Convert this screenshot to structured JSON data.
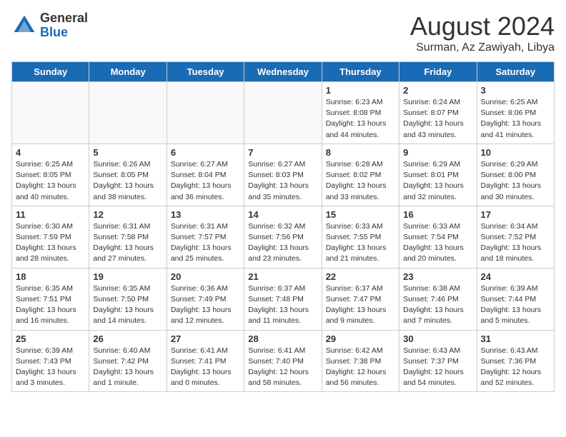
{
  "header": {
    "logo_general": "General",
    "logo_blue": "Blue",
    "month_year": "August 2024",
    "location": "Surman, Az Zawiyah, Libya"
  },
  "days_of_week": [
    "Sunday",
    "Monday",
    "Tuesday",
    "Wednesday",
    "Thursday",
    "Friday",
    "Saturday"
  ],
  "weeks": [
    [
      {
        "day": "",
        "info": "",
        "empty": true
      },
      {
        "day": "",
        "info": "",
        "empty": true
      },
      {
        "day": "",
        "info": "",
        "empty": true
      },
      {
        "day": "",
        "info": "",
        "empty": true
      },
      {
        "day": "1",
        "info": "Sunrise: 6:23 AM\nSunset: 8:08 PM\nDaylight: 13 hours\nand 44 minutes.",
        "empty": false
      },
      {
        "day": "2",
        "info": "Sunrise: 6:24 AM\nSunset: 8:07 PM\nDaylight: 13 hours\nand 43 minutes.",
        "empty": false
      },
      {
        "day": "3",
        "info": "Sunrise: 6:25 AM\nSunset: 8:06 PM\nDaylight: 13 hours\nand 41 minutes.",
        "empty": false
      }
    ],
    [
      {
        "day": "4",
        "info": "Sunrise: 6:25 AM\nSunset: 8:05 PM\nDaylight: 13 hours\nand 40 minutes.",
        "empty": false
      },
      {
        "day": "5",
        "info": "Sunrise: 6:26 AM\nSunset: 8:05 PM\nDaylight: 13 hours\nand 38 minutes.",
        "empty": false
      },
      {
        "day": "6",
        "info": "Sunrise: 6:27 AM\nSunset: 8:04 PM\nDaylight: 13 hours\nand 36 minutes.",
        "empty": false
      },
      {
        "day": "7",
        "info": "Sunrise: 6:27 AM\nSunset: 8:03 PM\nDaylight: 13 hours\nand 35 minutes.",
        "empty": false
      },
      {
        "day": "8",
        "info": "Sunrise: 6:28 AM\nSunset: 8:02 PM\nDaylight: 13 hours\nand 33 minutes.",
        "empty": false
      },
      {
        "day": "9",
        "info": "Sunrise: 6:29 AM\nSunset: 8:01 PM\nDaylight: 13 hours\nand 32 minutes.",
        "empty": false
      },
      {
        "day": "10",
        "info": "Sunrise: 6:29 AM\nSunset: 8:00 PM\nDaylight: 13 hours\nand 30 minutes.",
        "empty": false
      }
    ],
    [
      {
        "day": "11",
        "info": "Sunrise: 6:30 AM\nSunset: 7:59 PM\nDaylight: 13 hours\nand 28 minutes.",
        "empty": false
      },
      {
        "day": "12",
        "info": "Sunrise: 6:31 AM\nSunset: 7:58 PM\nDaylight: 13 hours\nand 27 minutes.",
        "empty": false
      },
      {
        "day": "13",
        "info": "Sunrise: 6:31 AM\nSunset: 7:57 PM\nDaylight: 13 hours\nand 25 minutes.",
        "empty": false
      },
      {
        "day": "14",
        "info": "Sunrise: 6:32 AM\nSunset: 7:56 PM\nDaylight: 13 hours\nand 23 minutes.",
        "empty": false
      },
      {
        "day": "15",
        "info": "Sunrise: 6:33 AM\nSunset: 7:55 PM\nDaylight: 13 hours\nand 21 minutes.",
        "empty": false
      },
      {
        "day": "16",
        "info": "Sunrise: 6:33 AM\nSunset: 7:54 PM\nDaylight: 13 hours\nand 20 minutes.",
        "empty": false
      },
      {
        "day": "17",
        "info": "Sunrise: 6:34 AM\nSunset: 7:52 PM\nDaylight: 13 hours\nand 18 minutes.",
        "empty": false
      }
    ],
    [
      {
        "day": "18",
        "info": "Sunrise: 6:35 AM\nSunset: 7:51 PM\nDaylight: 13 hours\nand 16 minutes.",
        "empty": false
      },
      {
        "day": "19",
        "info": "Sunrise: 6:35 AM\nSunset: 7:50 PM\nDaylight: 13 hours\nand 14 minutes.",
        "empty": false
      },
      {
        "day": "20",
        "info": "Sunrise: 6:36 AM\nSunset: 7:49 PM\nDaylight: 13 hours\nand 12 minutes.",
        "empty": false
      },
      {
        "day": "21",
        "info": "Sunrise: 6:37 AM\nSunset: 7:48 PM\nDaylight: 13 hours\nand 11 minutes.",
        "empty": false
      },
      {
        "day": "22",
        "info": "Sunrise: 6:37 AM\nSunset: 7:47 PM\nDaylight: 13 hours\nand 9 minutes.",
        "empty": false
      },
      {
        "day": "23",
        "info": "Sunrise: 6:38 AM\nSunset: 7:46 PM\nDaylight: 13 hours\nand 7 minutes.",
        "empty": false
      },
      {
        "day": "24",
        "info": "Sunrise: 6:39 AM\nSunset: 7:44 PM\nDaylight: 13 hours\nand 5 minutes.",
        "empty": false
      }
    ],
    [
      {
        "day": "25",
        "info": "Sunrise: 6:39 AM\nSunset: 7:43 PM\nDaylight: 13 hours\nand 3 minutes.",
        "empty": false
      },
      {
        "day": "26",
        "info": "Sunrise: 6:40 AM\nSunset: 7:42 PM\nDaylight: 13 hours\nand 1 minute.",
        "empty": false
      },
      {
        "day": "27",
        "info": "Sunrise: 6:41 AM\nSunset: 7:41 PM\nDaylight: 13 hours\nand 0 minutes.",
        "empty": false
      },
      {
        "day": "28",
        "info": "Sunrise: 6:41 AM\nSunset: 7:40 PM\nDaylight: 12 hours\nand 58 minutes.",
        "empty": false
      },
      {
        "day": "29",
        "info": "Sunrise: 6:42 AM\nSunset: 7:38 PM\nDaylight: 12 hours\nand 56 minutes.",
        "empty": false
      },
      {
        "day": "30",
        "info": "Sunrise: 6:43 AM\nSunset: 7:37 PM\nDaylight: 12 hours\nand 54 minutes.",
        "empty": false
      },
      {
        "day": "31",
        "info": "Sunrise: 6:43 AM\nSunset: 7:36 PM\nDaylight: 12 hours\nand 52 minutes.",
        "empty": false
      }
    ]
  ]
}
